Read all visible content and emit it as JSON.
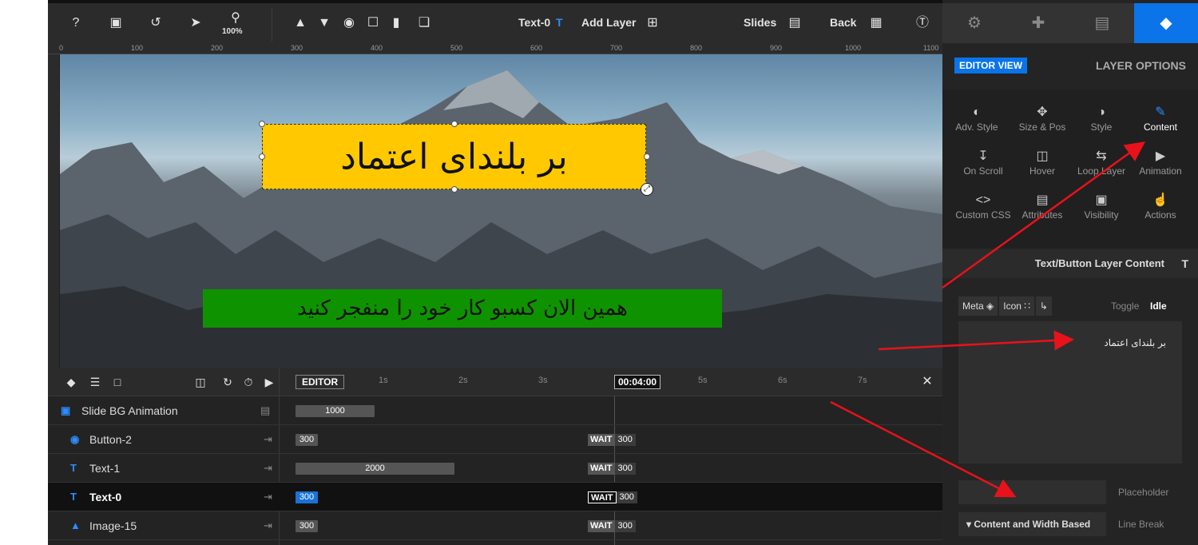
{
  "topbar": {
    "zoom": "100%",
    "layer_name": "Text-0",
    "add_layer": "Add Layer",
    "slides": "Slides",
    "back": "Back"
  },
  "ruler": [
    "0",
    "100",
    "200",
    "300",
    "400",
    "500",
    "600",
    "700",
    "800",
    "900",
    "1000",
    "1100"
  ],
  "canvas": {
    "main_text": "بر بلندای اعتماد",
    "green_text": "همین الان کسبو کار خود را منفجر کنید"
  },
  "timeline": {
    "editor": "EDITOR",
    "time_now": "00:04:00",
    "marks": [
      "1s",
      "2s",
      "3s",
      "5s",
      "6s",
      "7s"
    ],
    "rows": [
      {
        "name": "Slide BG Animation",
        "icon": "image-icon",
        "bar": "1000",
        "wait": "",
        "wait_val": ""
      },
      {
        "name": "Button-2",
        "icon": "button-icon",
        "bar": "300",
        "wait": "WAIT",
        "wait_val": "300"
      },
      {
        "name": "Text-1",
        "icon": "text-icon",
        "bar": "2000",
        "wait": "WAIT",
        "wait_val": "300"
      },
      {
        "name": "Text-0",
        "icon": "text-icon",
        "bar": "300",
        "wait": "WAIT",
        "wait_val": "300"
      },
      {
        "name": "Image-15",
        "icon": "image-icon",
        "bar": "300",
        "wait": "WAIT",
        "wait_val": "300"
      }
    ]
  },
  "side": {
    "editor_view": "EDITOR VIEW",
    "layer_options": "LAYER OPTIONS",
    "options": [
      "Adv. Style",
      "Size & Pos",
      "Style",
      "Content",
      "On Scroll",
      "Hover",
      "Loop Layer",
      "Animation",
      "Custom CSS",
      "Attributes",
      "Visibility",
      "Actions"
    ],
    "section_title": "Text/Button Layer Content",
    "meta": "Meta",
    "icon": "Icon",
    "toggle": "Toggle",
    "idle": "Idle",
    "content_value": "بر بلندای اعتماد",
    "placeholder_label": "Placeholder",
    "line_break_value": "Content and Width Based",
    "line_break_label": "Line Break"
  },
  "colors": {
    "accent": "#0a74e8",
    "yellow": "#ffc800",
    "green": "#0f9200",
    "arrow": "#e8121a"
  }
}
